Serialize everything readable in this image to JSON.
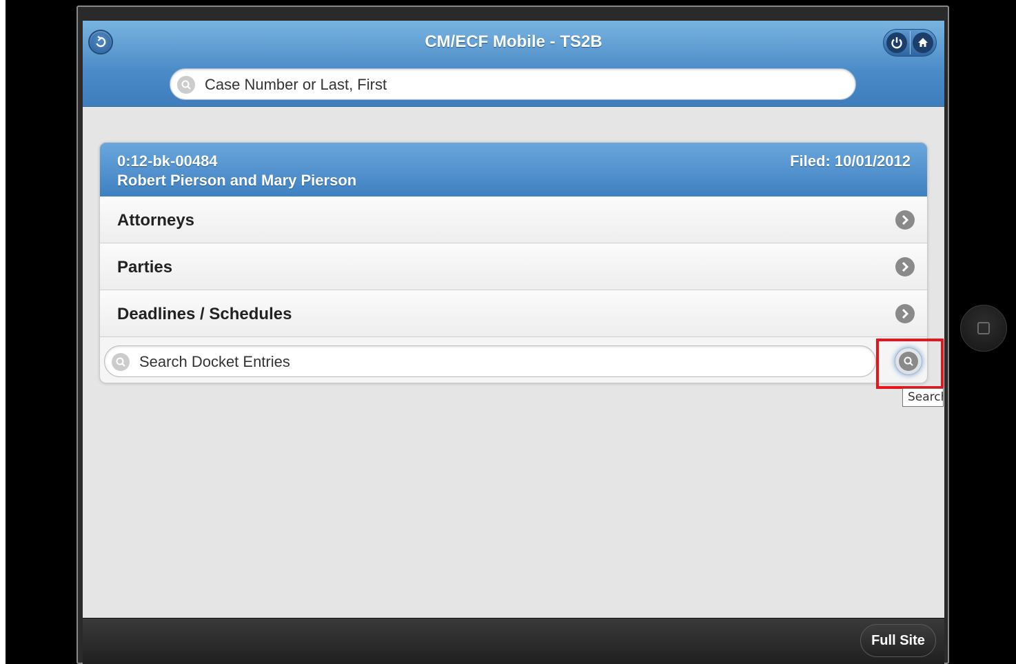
{
  "header": {
    "title": "CM/ECF Mobile - TS2B",
    "search_placeholder": "Case Number or Last, First"
  },
  "case": {
    "number": "0:12-bk-00484",
    "name": "Robert Pierson and Mary Pierson",
    "filed": "Filed: 10/01/2012"
  },
  "menu": [
    {
      "label": "Attorneys"
    },
    {
      "label": "Parties"
    },
    {
      "label": "Deadlines / Schedules"
    }
  ],
  "docket_search": {
    "placeholder": "Search Docket Entries",
    "tooltip": "Search"
  },
  "footer": {
    "full_site_label": "Full Site"
  },
  "icons": {
    "back": "back-arrow-icon",
    "power": "power-icon",
    "home": "home-icon",
    "search": "search-icon",
    "chevron": "chevron-right-icon"
  },
  "colors": {
    "header_blue": "#4a8ac7",
    "highlight_red": "#e8141c",
    "footer_dark": "#2a2a2a"
  }
}
